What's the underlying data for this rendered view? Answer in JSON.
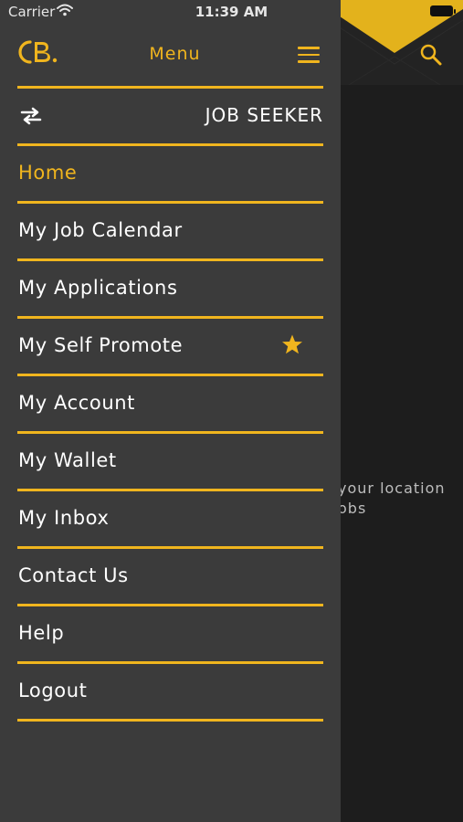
{
  "status_bar": {
    "carrier": "Carrier",
    "time": "11:39 AM"
  },
  "header": {
    "title": "Menu"
  },
  "role_switch": {
    "label": "JOB SEEKER"
  },
  "menu_items": [
    {
      "label": "Home",
      "active": true
    },
    {
      "label": "My Job Calendar"
    },
    {
      "label": "My Applications"
    },
    {
      "label": "My Self Promote",
      "icon": "star-icon"
    },
    {
      "label": "My Account"
    },
    {
      "label": "My Wallet"
    },
    {
      "label": "My Inbox"
    },
    {
      "label": "Contact Us"
    },
    {
      "label": "Help"
    },
    {
      "label": "Logout"
    }
  ],
  "background_page": {
    "text_line1": "your location",
    "text_line2": "obs"
  },
  "colors": {
    "accent": "#f0b51e",
    "drawer_bg": "#3b3b3b",
    "page_bg": "#1d1d1d"
  }
}
